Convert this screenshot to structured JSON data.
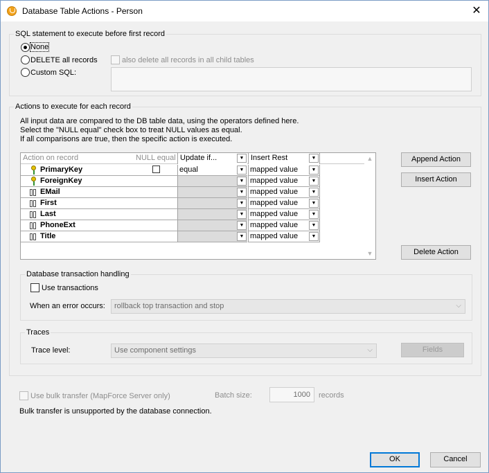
{
  "window": {
    "title": "Database Table Actions - Person",
    "close_glyph": "✕"
  },
  "sql_before": {
    "label": "SQL statement to execute before first record",
    "none_label": "None",
    "delete_label": "DELETE all records",
    "child_tables_label": "also delete all records in all child tables",
    "custom_label": "Custom SQL:",
    "selected": "None"
  },
  "actions": {
    "label": "Actions to execute for each record",
    "info_lines": [
      "All input data are compared to the DB table data, using the operators defined here.",
      "Select the \"NULL equal\" check box to treat NULL values as equal.",
      "If all comparisons are true, then the specific action is executed."
    ],
    "headers": {
      "action_on_record": "Action on record",
      "null_equal": "NULL equal",
      "update_if": "Update if...",
      "insert_rest": "Insert Rest"
    },
    "rows": [
      {
        "name": "PrimaryKey",
        "icon": "key-icon",
        "update": "equal",
        "insert": "mapped value",
        "null_checkbox": true
      },
      {
        "name": "ForeignKey",
        "icon": "key-icon",
        "update": "",
        "insert": "mapped value",
        "null_checkbox": false
      },
      {
        "name": "EMail",
        "icon": "field-icon",
        "update": "",
        "insert": "mapped value",
        "null_checkbox": false
      },
      {
        "name": "First",
        "icon": "field-icon",
        "update": "",
        "insert": "mapped value",
        "null_checkbox": false
      },
      {
        "name": "Last",
        "icon": "field-icon",
        "update": "",
        "insert": "mapped value",
        "null_checkbox": false
      },
      {
        "name": "PhoneExt",
        "icon": "field-icon",
        "update": "",
        "insert": "mapped value",
        "null_checkbox": false
      },
      {
        "name": "Title",
        "icon": "field-icon",
        "update": "",
        "insert": "mapped value",
        "null_checkbox": false
      }
    ],
    "append_button": "Append Action",
    "insert_button": "Insert Action",
    "delete_button": "Delete Action"
  },
  "transaction": {
    "label": "Database transaction handling",
    "use_transactions_label": "Use transactions",
    "error_label": "When an error occurs:",
    "error_value": "rollback top transaction and stop"
  },
  "traces": {
    "label": "Traces",
    "level_label": "Trace level:",
    "level_value": "Use component settings",
    "fields_button": "Fields"
  },
  "bulk": {
    "use_bulk_label": "Use bulk transfer (MapForce Server only)",
    "batch_label": "Batch size:",
    "batch_value": "1000",
    "records_label": "records",
    "note": "Bulk transfer is unsupported by the database connection."
  },
  "buttons": {
    "ok": "OK",
    "cancel": "Cancel"
  },
  "colors": {
    "accent": "#0078d7",
    "app_icon": "#f2a21b"
  }
}
